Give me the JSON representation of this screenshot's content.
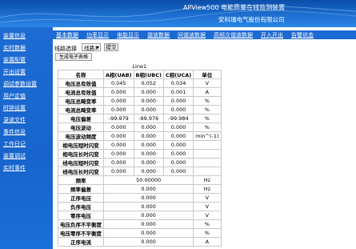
{
  "header": {
    "title": "APView500 电能质量在线监测装置",
    "company": "安科瑞电气股份有限公司"
  },
  "sidebar": {
    "items": [
      "装置信息",
      "实时数据",
      "装置配置",
      "开出设置",
      "调试参数设置",
      "用户定值",
      "时钟设置",
      "录波文件",
      "事件信息",
      "工作日记",
      "装置调试",
      "实时事件"
    ]
  },
  "topnav": {
    "items": [
      "基本数据",
      "功率显示",
      "电能显示",
      "谐波数据",
      "间谐波数据",
      "高频次谐波数据",
      "开入开出",
      "告警状态"
    ]
  },
  "controls": {
    "line_label": "线路选择",
    "line_value": "线路1",
    "submit_label": "提交",
    "report_label": "生成电子表格"
  },
  "table": {
    "caption": "Line1",
    "headers": [
      "名称",
      "A相(UAB)",
      "B相(UBC)",
      "C相(UCA)",
      "单位"
    ],
    "rows": [
      {
        "name": "电压总有效值",
        "a": "0.045",
        "b": "0.052",
        "c": "0.034",
        "unit": "V"
      },
      {
        "name": "电流总有效值",
        "a": "0.000",
        "b": "0.000",
        "c": "0.001",
        "unit": "A"
      },
      {
        "name": "电压总畸变率",
        "a": "0.000",
        "b": "0.000",
        "c": "0.000",
        "unit": "%"
      },
      {
        "name": "电流总畸变率",
        "a": "0.000",
        "b": "0.000",
        "c": "0.000",
        "unit": "%"
      },
      {
        "name": "电压偏差",
        "a": "-99.979",
        "b": "-99.976",
        "c": "-99.984",
        "unit": "%"
      },
      {
        "name": "电压波动",
        "a": "0.000",
        "b": "0.000",
        "c": "0.000",
        "unit": "%"
      },
      {
        "name": "电压波动频度",
        "a": "0.000",
        "b": "0.000",
        "c": "0.000",
        "unit": "min^(-1)"
      },
      {
        "name": "相电压短时闪变",
        "a": "0.000",
        "b": "0.000",
        "c": "0.000",
        "unit": ""
      },
      {
        "name": "相电压长时闪变",
        "a": "0.000",
        "b": "0.000",
        "c": "0.000",
        "unit": ""
      },
      {
        "name": "线电压短时闪变",
        "a": "0.000",
        "b": "0.000",
        "c": "0.000",
        "unit": ""
      },
      {
        "name": "线电压长时闪变",
        "a": "0.000",
        "b": "0.000",
        "c": "0.000",
        "unit": ""
      }
    ],
    "single_rows": [
      {
        "name": "频率",
        "value": "50.00000",
        "unit": "Hz"
      },
      {
        "name": "频率偏差",
        "value": "0.000",
        "unit": "Hz"
      },
      {
        "name": "正序电压",
        "value": "0.000",
        "unit": "V"
      },
      {
        "name": "负序电压",
        "value": "0.000",
        "unit": "V"
      },
      {
        "name": "零序电压",
        "value": "0.000",
        "unit": "V"
      },
      {
        "name": "电压负序不平衡度",
        "value": "0.000",
        "unit": "%"
      },
      {
        "name": "电压零序不平衡度",
        "value": "0.000",
        "unit": "%"
      },
      {
        "name": "正序电流",
        "value": "0.000",
        "unit": "A"
      }
    ]
  }
}
